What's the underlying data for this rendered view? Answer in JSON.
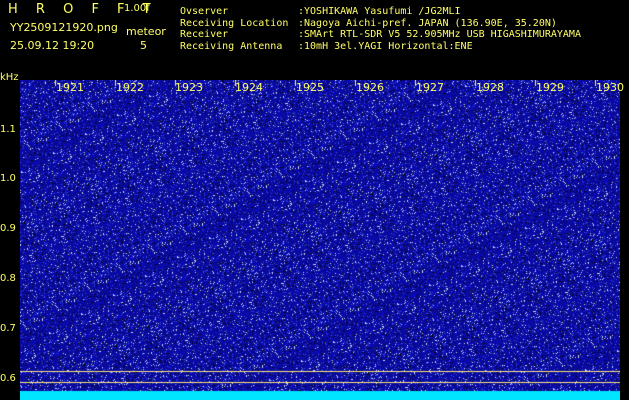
{
  "header": {
    "title": "H R O F F T",
    "version": "1.00f",
    "filename": "YY2509121920.png",
    "datetime": "25.09.12 19:20",
    "meteor_label": "meteor",
    "meteor_count": "5"
  },
  "info": [
    {
      "label": "Ovserver",
      "value": ":YOSHIKAWA Yasufumi /JG2MLI"
    },
    {
      "label": "Receiving Location",
      "value": ":Nagoya Aichi-pref. JAPAN (136.90E, 35.20N)"
    },
    {
      "label": "Receiver",
      "value": ":SMArt RTL-SDR V5 52.905MHz USB HIGASHIMURAYAMA"
    },
    {
      "label": "Receiving Antenna",
      "value": ":10mH 3el.YAGI Horizontal:ENE"
    }
  ],
  "axis": {
    "unit": "kHz",
    "y_ticks": [
      "1.1",
      "1.0",
      "0.9",
      "0.8",
      "0.7",
      "0.6"
    ],
    "y_values": [
      1.1,
      1.0,
      0.9,
      0.8,
      0.7,
      0.6
    ],
    "x_ticks": [
      "1921",
      "1922",
      "1923",
      "1924",
      "1925",
      "1926",
      "1927",
      "1928",
      "1929",
      "1930"
    ]
  },
  "colors": {
    "background": "#000000",
    "noise_base": "#1a1ab4",
    "text": "#ffff66",
    "bottom_band": "#00e5ff"
  }
}
